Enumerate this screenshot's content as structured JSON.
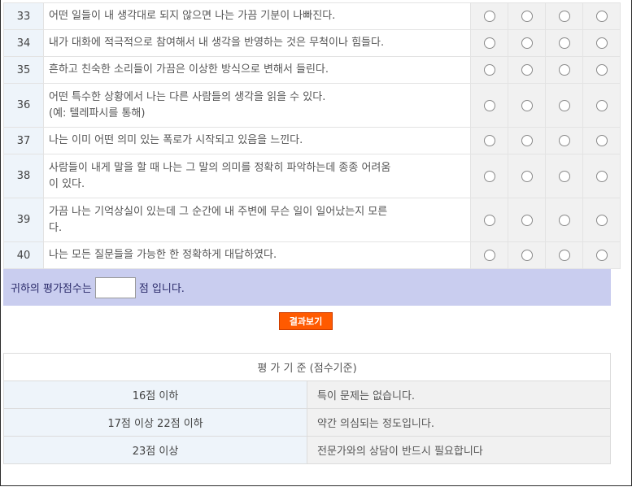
{
  "questions": [
    {
      "num": "33",
      "text": "어떤 일들이 내 생각대로 되지 않으면 나는 가끔 기분이 나빠진다."
    },
    {
      "num": "34",
      "text": "내가 대화에 적극적으로 참여해서 내 생각을 반영하는 것은 무척이나 힘들다."
    },
    {
      "num": "35",
      "text": "흔하고 친숙한 소리들이 가끔은 이상한 방식으로 변해서 들린다."
    },
    {
      "num": "36",
      "text": "어떤 특수한 상황에서 나는 다른 사람들의 생각을 읽을 수 있다.",
      "text2": "(예: 텔레파시를 통해)"
    },
    {
      "num": "37",
      "text": "나는 이미 어떤 의미 있는 폭로가 시작되고 있음을 느낀다."
    },
    {
      "num": "38",
      "text": "사람들이 내게 말을 할 때 나는 그 말의 의미를 정확히 파악하는데 종종 어려움",
      "text2": "이 있다."
    },
    {
      "num": "39",
      "text": "가끔 나는 기억상실이 있는데 그 순간에 내 주변에 무슨 일이 일어났는지 모른",
      "text2": "다."
    },
    {
      "num": "40",
      "text": "나는 모든 질문들을 가능한 한 정확하게 대답하였다."
    }
  ],
  "score": {
    "prefix": "귀하의 평가점수는",
    "value": "",
    "suffix": "점 입니다."
  },
  "result_button": "결과보기",
  "criteria": {
    "title": "평 가 기 준 (점수기준)",
    "rows": [
      {
        "range": "16점 이하",
        "desc": "특이 문제는 없습니다."
      },
      {
        "range": "17점 이상 22점 이하",
        "desc": "약간 의심되는 정도입니다."
      },
      {
        "range": "23점 이상",
        "desc": "전문가와의 상담이 반드시 필요합니다"
      }
    ]
  }
}
